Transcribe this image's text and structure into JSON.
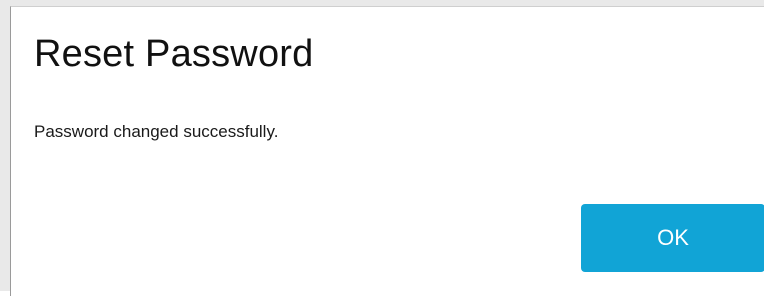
{
  "dialog": {
    "title": "Reset Password",
    "message": "Password changed successfully.",
    "ok_label": "OK",
    "accent_color": "#11a4d6"
  }
}
